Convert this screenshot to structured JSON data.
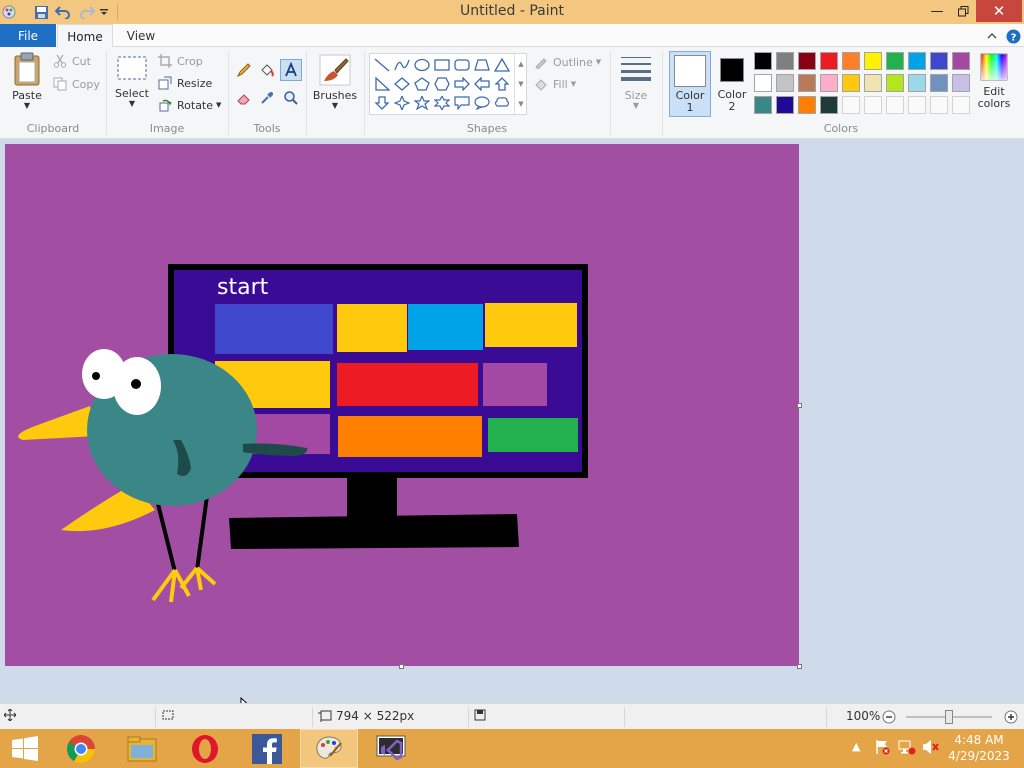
{
  "window": {
    "title": "Untitled - Paint",
    "controls": [
      "minimize",
      "restore",
      "close"
    ]
  },
  "tabs": {
    "file": "File",
    "home": "Home",
    "view": "View"
  },
  "ribbon": {
    "clipboard": {
      "label": "Clipboard",
      "paste": "Paste",
      "cut": "Cut",
      "copy": "Copy"
    },
    "image": {
      "label": "Image",
      "select": "Select",
      "crop": "Crop",
      "resize": "Resize",
      "rotate": "Rotate"
    },
    "tools": {
      "label": "Tools",
      "active": "text"
    },
    "brushes": {
      "label": "Brushes"
    },
    "shapes": {
      "label": "Shapes",
      "outline": "Outline",
      "fill": "Fill"
    },
    "size": {
      "label": "Size"
    },
    "color1": {
      "line1": "Color",
      "line2": "1",
      "value": "#ffffff"
    },
    "color2": {
      "line1": "Color",
      "line2": "2",
      "value": "#000000"
    },
    "colors": {
      "label": "Colors",
      "edit_line1": "Edit",
      "edit_line2": "colors",
      "palette_row1": [
        "#000000",
        "#7f7f7f",
        "#880015",
        "#ed1c24",
        "#ff7f27",
        "#fff200",
        "#22b14c",
        "#00a2e8",
        "#3f48cc",
        "#a349a4"
      ],
      "palette_row2": [
        "#ffffff",
        "#c3c3c3",
        "#b97a57",
        "#ffaec9",
        "#ffc90e",
        "#efe4b0",
        "#b5e61d",
        "#99d9ea",
        "#7092be",
        "#c8bfe7"
      ],
      "palette_row3": [
        "#3b8686",
        "#1f0a96",
        "#ff7f00",
        "#1f3a3a"
      ]
    }
  },
  "canvas": {
    "background": "#a24ea3",
    "monitor_text": "start"
  },
  "status": {
    "canvas_size": "794 × 522px",
    "zoom": "100%"
  },
  "taskbar": {
    "apps": [
      "windows-start",
      "chrome",
      "file-explorer",
      "opera",
      "facebook",
      "paint",
      "visual-studio"
    ],
    "active_app": "paint",
    "time": "4:48 AM",
    "date": "4/29/2023"
  }
}
